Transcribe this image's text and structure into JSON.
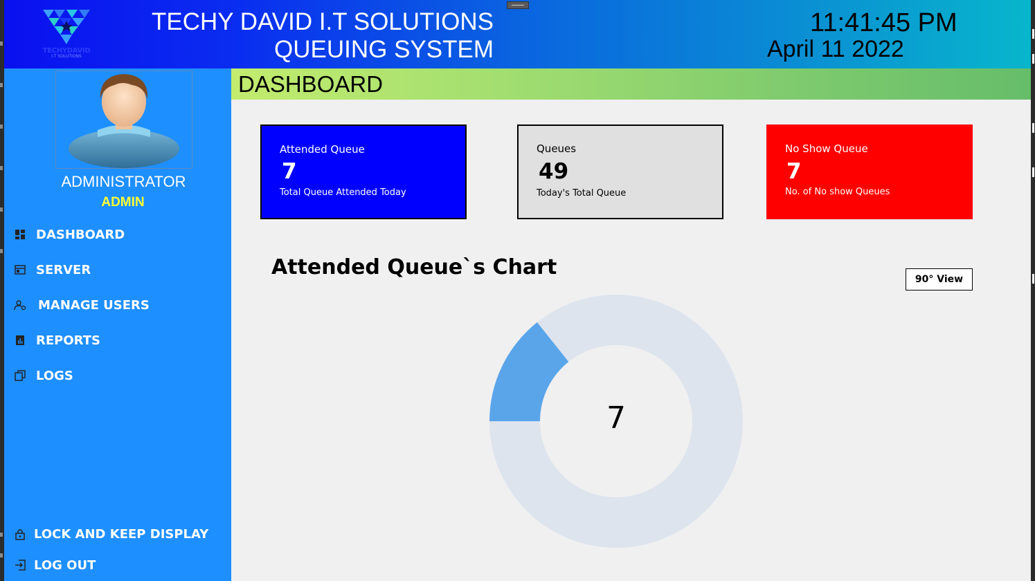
{
  "header": {
    "company": "TECHY DAVID I.T SOLUTIONS",
    "system": "QUEUING SYSTEM",
    "time": "11:41:45 PM",
    "date": "April 11 2022",
    "logo_text": "TECHYDAVID",
    "logo_sub": "I.T SOLUTIONS"
  },
  "user": {
    "name": "ADMINISTRATOR",
    "role": "ADMIN"
  },
  "nav": {
    "items": [
      {
        "label": "DASHBOARD",
        "icon": "dashboard-icon"
      },
      {
        "label": "SERVER",
        "icon": "server-icon"
      },
      {
        "label": "MANAGE USERS",
        "icon": "manage-users-icon"
      },
      {
        "label": "REPORTS",
        "icon": "reports-icon"
      },
      {
        "label": "LOGS",
        "icon": "logs-icon"
      }
    ],
    "lock_label": "LOCK AND KEEP DISPLAY",
    "logout_label": "LOG OUT"
  },
  "page": {
    "title": "DASHBOARD"
  },
  "cards": {
    "attended": {
      "title": "Attended Queue",
      "value": "7",
      "subtitle": "Total Queue Attended Today",
      "color": "#0000ff"
    },
    "queues": {
      "title": "Queues",
      "value": "49",
      "subtitle": "Today's Total Queue",
      "color": "#e0e0e0"
    },
    "noshow": {
      "title": "No Show Queue",
      "value": "7",
      "subtitle": "No. of No show Queues",
      "color": "#ff0000"
    }
  },
  "chart": {
    "title": "Attended Queue`s Chart",
    "view_button": "90° View",
    "center_label": "7"
  },
  "chart_data": {
    "type": "pie",
    "title": "Attended Queue`s Chart",
    "series": [
      {
        "values": [
          7,
          42
        ]
      }
    ],
    "total": 49,
    "colors": [
      "#5aa5ea",
      "#dde4ee"
    ],
    "center_value": "7"
  },
  "colors": {
    "sidebar": "#1e8fff",
    "accent_yellow": "#ffff33",
    "header_start": "#0a10f0",
    "header_end": "#08b6cc"
  }
}
